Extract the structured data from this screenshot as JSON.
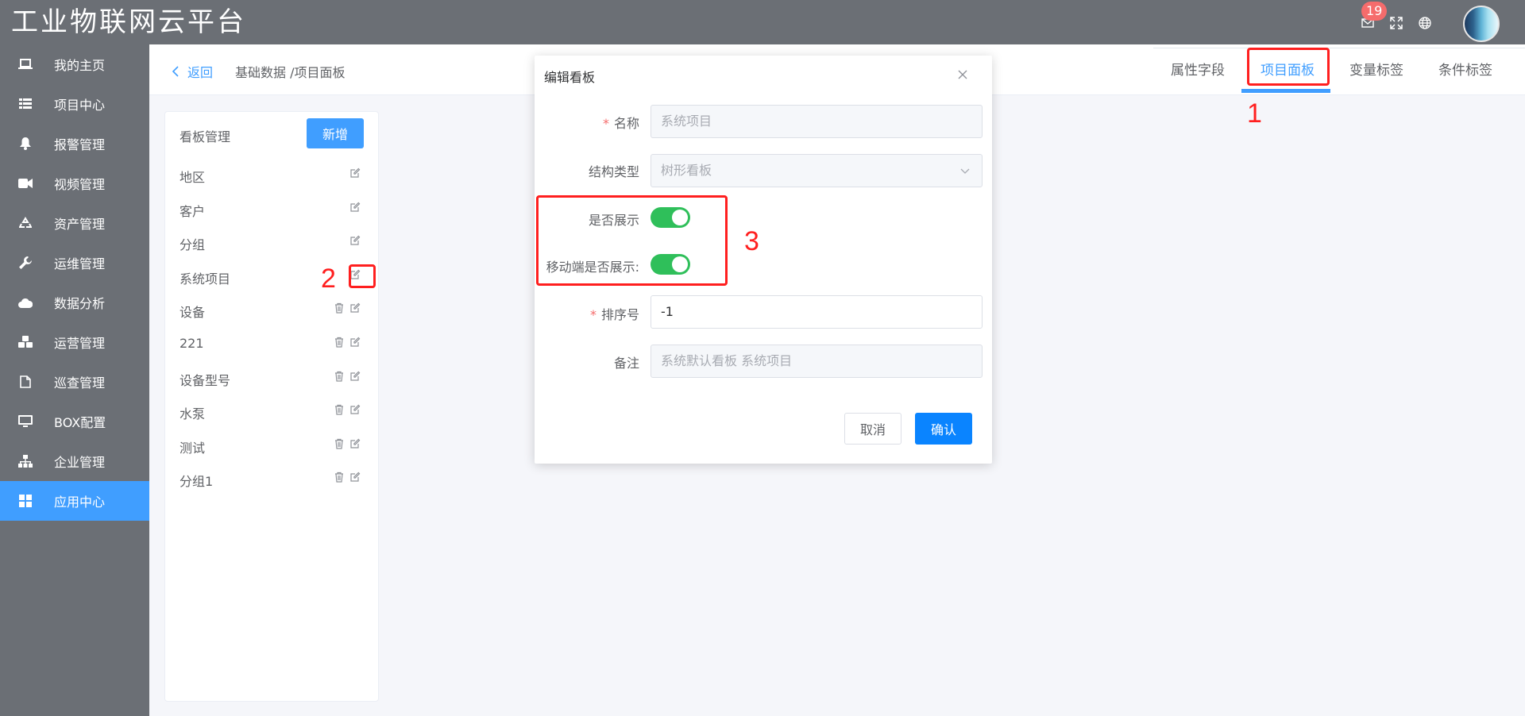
{
  "app": {
    "title": "工业物联网云平台"
  },
  "header": {
    "notification_count": "19"
  },
  "sidebar": {
    "items": [
      {
        "label": "我的主页",
        "icon": "laptop-icon"
      },
      {
        "label": "项目中心",
        "icon": "list-icon"
      },
      {
        "label": "报警管理",
        "icon": "bell-icon"
      },
      {
        "label": "视频管理",
        "icon": "video-icon"
      },
      {
        "label": "资产管理",
        "icon": "recycle-icon"
      },
      {
        "label": "运维管理",
        "icon": "wrench-icon"
      },
      {
        "label": "数据分析",
        "icon": "cloud-icon"
      },
      {
        "label": "运营管理",
        "icon": "cubes-icon"
      },
      {
        "label": "巡查管理",
        "icon": "file-icon"
      },
      {
        "label": "BOX配置",
        "icon": "monitor-icon"
      },
      {
        "label": "企业管理",
        "icon": "sitemap-icon"
      },
      {
        "label": "应用中心",
        "icon": "grid-icon",
        "active": true
      }
    ]
  },
  "breadcrumb": {
    "back": "返回",
    "path": "基础数据 /项目面板"
  },
  "tabs": [
    {
      "label": "属性字段"
    },
    {
      "label": "项目面板",
      "active": true
    },
    {
      "label": "变量标签"
    },
    {
      "label": "条件标签"
    }
  ],
  "panel": {
    "title": "看板管理",
    "add_label": "新增",
    "items": [
      {
        "label": "地区",
        "deletable": false
      },
      {
        "label": "客户",
        "deletable": false
      },
      {
        "label": "分组",
        "deletable": false
      },
      {
        "label": "系统项目",
        "deletable": false
      },
      {
        "label": "设备",
        "deletable": true
      },
      {
        "label": "221",
        "deletable": true
      },
      {
        "label": "设备型号",
        "deletable": true
      },
      {
        "label": "水泵",
        "deletable": true
      },
      {
        "label": "测试",
        "deletable": true
      },
      {
        "label": "分组1",
        "deletable": true
      }
    ]
  },
  "modal": {
    "title": "编辑看板",
    "name_label": "名称",
    "name_value": "系统项目",
    "type_label": "结构类型",
    "type_value": "树形看板",
    "show_label": "是否展示",
    "show_on": true,
    "mobile_label": "移动端是否展示:",
    "mobile_on": true,
    "sort_label": "排序号",
    "sort_value": "-1",
    "remark_label": "备注",
    "remark_value": "系统默认看板 系统项目",
    "cancel_label": "取消",
    "ok_label": "确认"
  },
  "annotations": {
    "a1": "1",
    "a2": "2",
    "a3": "3"
  },
  "colors": {
    "accent": "#409eff",
    "sidebar": "#6b6f75",
    "switch_on": "#2fbf5a",
    "annotation": "#ff1f1f"
  }
}
